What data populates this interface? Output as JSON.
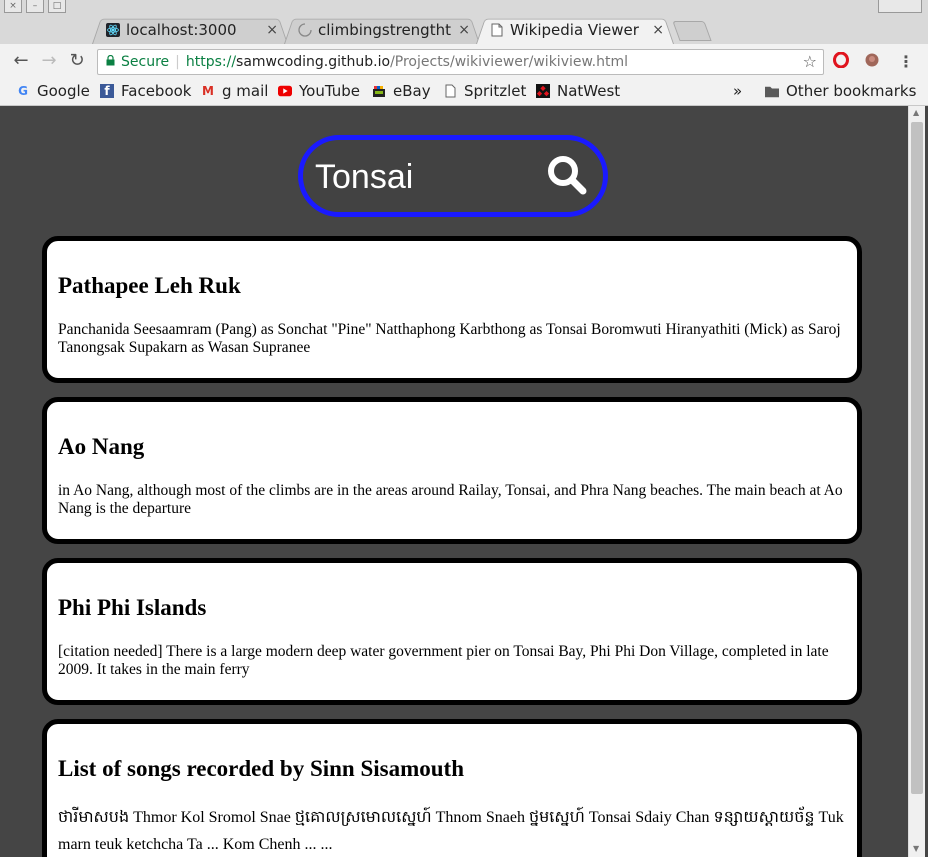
{
  "browser": {
    "tabs": [
      {
        "title": "localhost:3000",
        "favicon": "react-icon",
        "active": false
      },
      {
        "title": "climbingstrengthtr",
        "favicon": "loading-spinner-icon",
        "active": false
      },
      {
        "title": "Wikipedia Viewer",
        "favicon": "page-icon",
        "active": true
      }
    ],
    "address": {
      "secure_label": "Secure",
      "scheme": "https://",
      "host": "samwcoding.github.io",
      "path": "/Projects/wikiviewer/wikiview.html"
    },
    "bookmarks": [
      {
        "label": "Google",
        "icon": "google-icon"
      },
      {
        "label": "Facebook",
        "icon": "facebook-icon"
      },
      {
        "label": "g mail",
        "icon": "gmail-icon"
      },
      {
        "label": "YouTube",
        "icon": "youtube-icon"
      },
      {
        "label": "eBay",
        "icon": "ebay-icon"
      },
      {
        "label": "Spritzlet",
        "icon": "page-icon"
      },
      {
        "label": "NatWest",
        "icon": "natwest-icon"
      }
    ],
    "overflow_label": "»",
    "other_bookmarks": "Other bookmarks"
  },
  "page": {
    "search_value": "Tonsai",
    "accent_color": "#1a1aff",
    "background_color": "#454545",
    "results": [
      {
        "title": "Pathapee Leh Ruk",
        "snippet": "Panchanida Seesaamram (Pang) as Sonchat \"Pine\" Natthaphong Karbthong as Tonsai Boromwuti Hiranyathiti (Mick) as Saroj Tanongsak Supakarn as Wasan Supranee"
      },
      {
        "title": "Ao Nang",
        "snippet": "in Ao Nang, although most of the climbs are in the areas around Railay, Tonsai, and Phra Nang beaches. The main beach at Ao Nang is the departure"
      },
      {
        "title": "Phi Phi Islands",
        "snippet": "[citation needed] There is a large modern deep water government pier on Tonsai Bay, Phi Phi Don Village, completed in late 2009. It takes in the main ferry"
      },
      {
        "title": "List of songs recorded by Sinn Sisamouth",
        "snippet": "ថារីមាសបង Thmor Kol Sromol Snae ថ្មគោលស្រមោលស្នេហ៍ Thnom Snaeh ថ្នមស្នេហ៍ Tonsai Sdaiy Chan ទន្សាយស្ដាយច័ន្ទ Tuk marn teuk ketchcha Ta ... Kom Chenh ... ..."
      }
    ]
  }
}
